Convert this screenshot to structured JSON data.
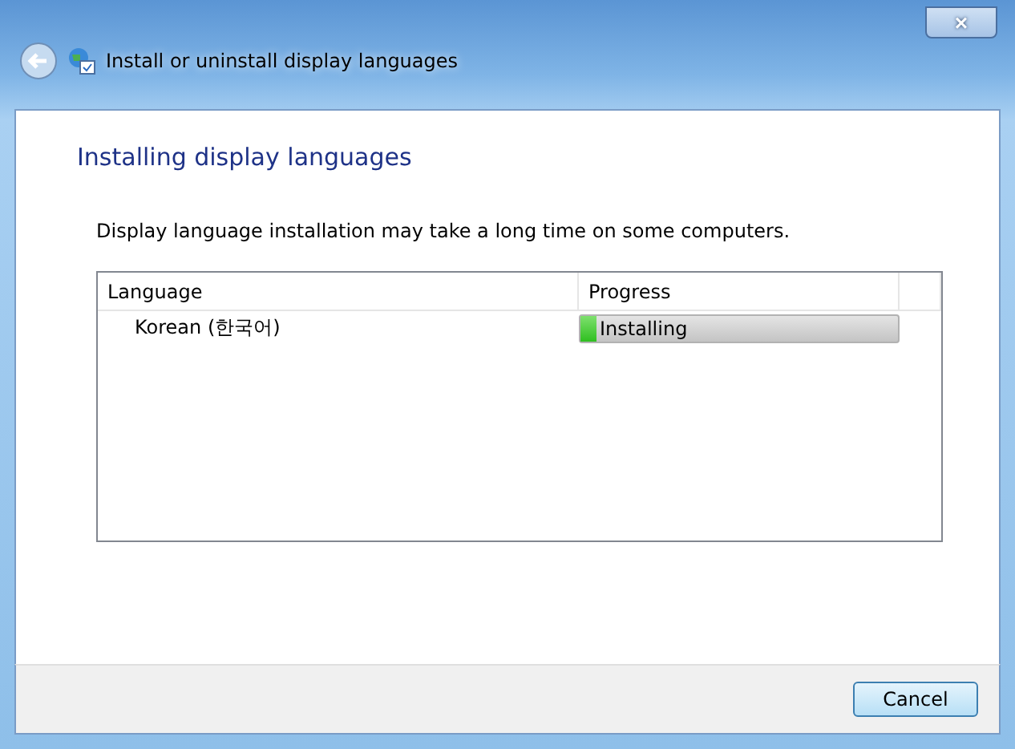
{
  "window": {
    "title": "Install or uninstall display languages",
    "close": "×"
  },
  "heading": "Installing display languages",
  "message": "Display language installation may take a long time on some computers.",
  "table": {
    "columns": [
      "Language",
      "Progress"
    ],
    "rows": [
      {
        "language": "Korean (한국어)",
        "status": "Installing",
        "level": 0.05
      }
    ]
  },
  "buttons": [
    "Cancel"
  ]
}
